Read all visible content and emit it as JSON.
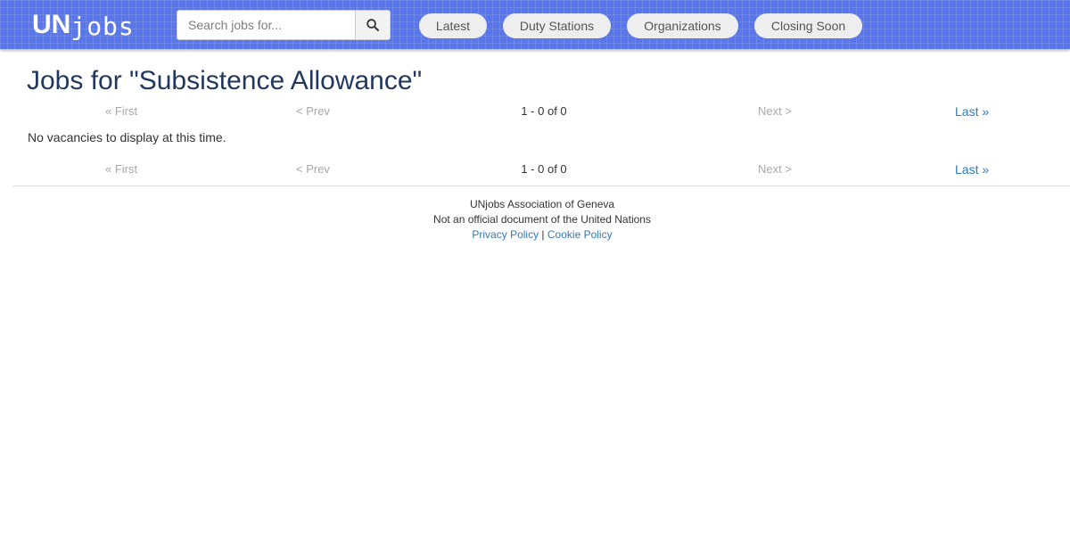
{
  "header": {
    "logo_un": "UN",
    "logo_jobs": "jobs",
    "search": {
      "placeholder": "Search jobs for...",
      "value": "",
      "button_icon": "search-icon"
    },
    "nav": [
      {
        "label": "Latest"
      },
      {
        "label": "Duty Stations"
      },
      {
        "label": "Organizations"
      },
      {
        "label": "Closing Soon"
      }
    ],
    "colors": {
      "bar": "#5a77ea",
      "pill": "#eeeeee"
    }
  },
  "main": {
    "title": "Jobs for \"Subsistence Allowance\"",
    "empty_message": "No vacancies to display at this time.",
    "pager_top": {
      "first": "« First",
      "prev": "< Prev",
      "count": "1 - 0 of 0",
      "next": "Next >",
      "last": "Last »"
    },
    "pager_bottom": {
      "first": "« First",
      "prev": "< Prev",
      "count": "1 - 0 of 0",
      "next": "Next >",
      "last": "Last »"
    },
    "colors": {
      "title": "#22385e",
      "link": "#337ab7",
      "disabled": "#a8a8a8"
    }
  },
  "footer": {
    "org": "UNjobs Association of Geneva",
    "disclaimer": "Not an official document of the United Nations",
    "privacy_link": "Privacy Policy",
    "separator": "|",
    "cookie_link": "Cookie Policy"
  }
}
